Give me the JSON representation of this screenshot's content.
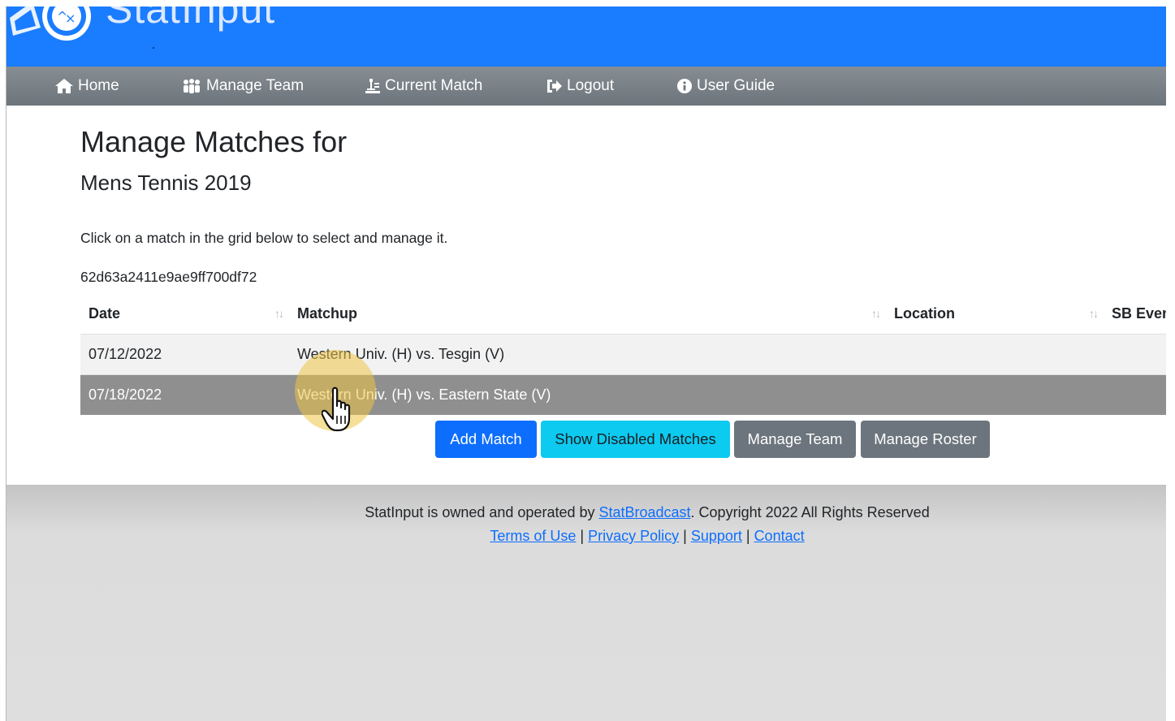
{
  "brand": {
    "name": "StatInput"
  },
  "nav": {
    "items": [
      {
        "label": "Home",
        "icon": "home-icon"
      },
      {
        "label": "Manage Team",
        "icon": "team-icon"
      },
      {
        "label": "Current Match",
        "icon": "match-icon"
      },
      {
        "label": "Logout",
        "icon": "logout-icon"
      },
      {
        "label": "User Guide",
        "icon": "info-icon"
      }
    ]
  },
  "main": {
    "title": "Manage Matches for",
    "subtitle": "Mens Tennis 2019",
    "instruction": "Click on a match in the grid below to select and manage it.",
    "id_text": "62d63a2411e9ae9ff700df72"
  },
  "table": {
    "columns": [
      "Date",
      "Matchup",
      "Location",
      "SB Even"
    ],
    "sort_glyph": "↑↓",
    "rows": [
      {
        "date": "07/12/2022",
        "matchup": "Western Univ. (H) vs. Tesgin (V)",
        "location": "",
        "sb": ""
      },
      {
        "date": "07/18/2022",
        "matchup": "Western Univ. (H) vs. Eastern State (V)",
        "location": "",
        "sb": ""
      }
    ],
    "selected_row": 1
  },
  "buttons": {
    "add_match": "Add Match",
    "show_disabled": "Show Disabled Matches",
    "manage_team": "Manage Team",
    "manage_roster": "Manage Roster"
  },
  "footer": {
    "text_before": "StatInput is owned and operated by ",
    "owner_link": "StatBroadcast",
    "text_after": ". Copyright 2022 All Rights Reserved",
    "links": [
      "Terms of Use",
      "Privacy Policy",
      "Support",
      "Contact"
    ],
    "separator": " | "
  },
  "colors": {
    "banner": "#1a7cff",
    "nav": "#6d757c",
    "primary": "#0d6efd",
    "info": "#0dcaf0",
    "secondary": "#6c757d",
    "selected_row": "#8f8f8f"
  }
}
